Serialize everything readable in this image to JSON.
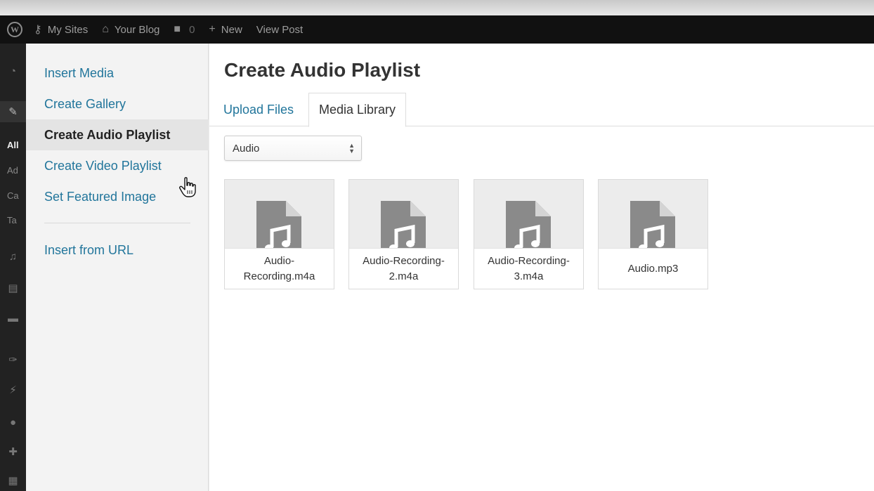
{
  "adminbar": {
    "my_sites": "My Sites",
    "your_blog": "Your Blog",
    "comments_count": "0",
    "new_label": "New",
    "view_post": "View Post"
  },
  "admin_side": {
    "sub_items": [
      "All",
      "Ad",
      "Ca",
      "Ta"
    ]
  },
  "media_menu": {
    "items": [
      {
        "label": "Insert Media"
      },
      {
        "label": "Create Gallery"
      },
      {
        "label": "Create Audio Playlist"
      },
      {
        "label": "Create Video Playlist"
      },
      {
        "label": "Set Featured Image"
      },
      {
        "label": "Insert from URL"
      }
    ],
    "active_index": 2
  },
  "frame": {
    "title": "Create Audio Playlist",
    "tabs": [
      {
        "label": "Upload Files"
      },
      {
        "label": "Media Library"
      }
    ],
    "active_tab": 1
  },
  "filter": {
    "selected": "Audio"
  },
  "attachments": [
    {
      "filename": "Audio-Recording.m4a"
    },
    {
      "filename": "Audio-Recording-2.m4a"
    },
    {
      "filename": "Audio-Recording-3.m4a"
    },
    {
      "filename": "Audio.mp3"
    }
  ],
  "colors": {
    "link": "#21759b",
    "adminbar": "#111111",
    "sidebar": "#222222",
    "icon_gray": "#8a8a8a"
  }
}
